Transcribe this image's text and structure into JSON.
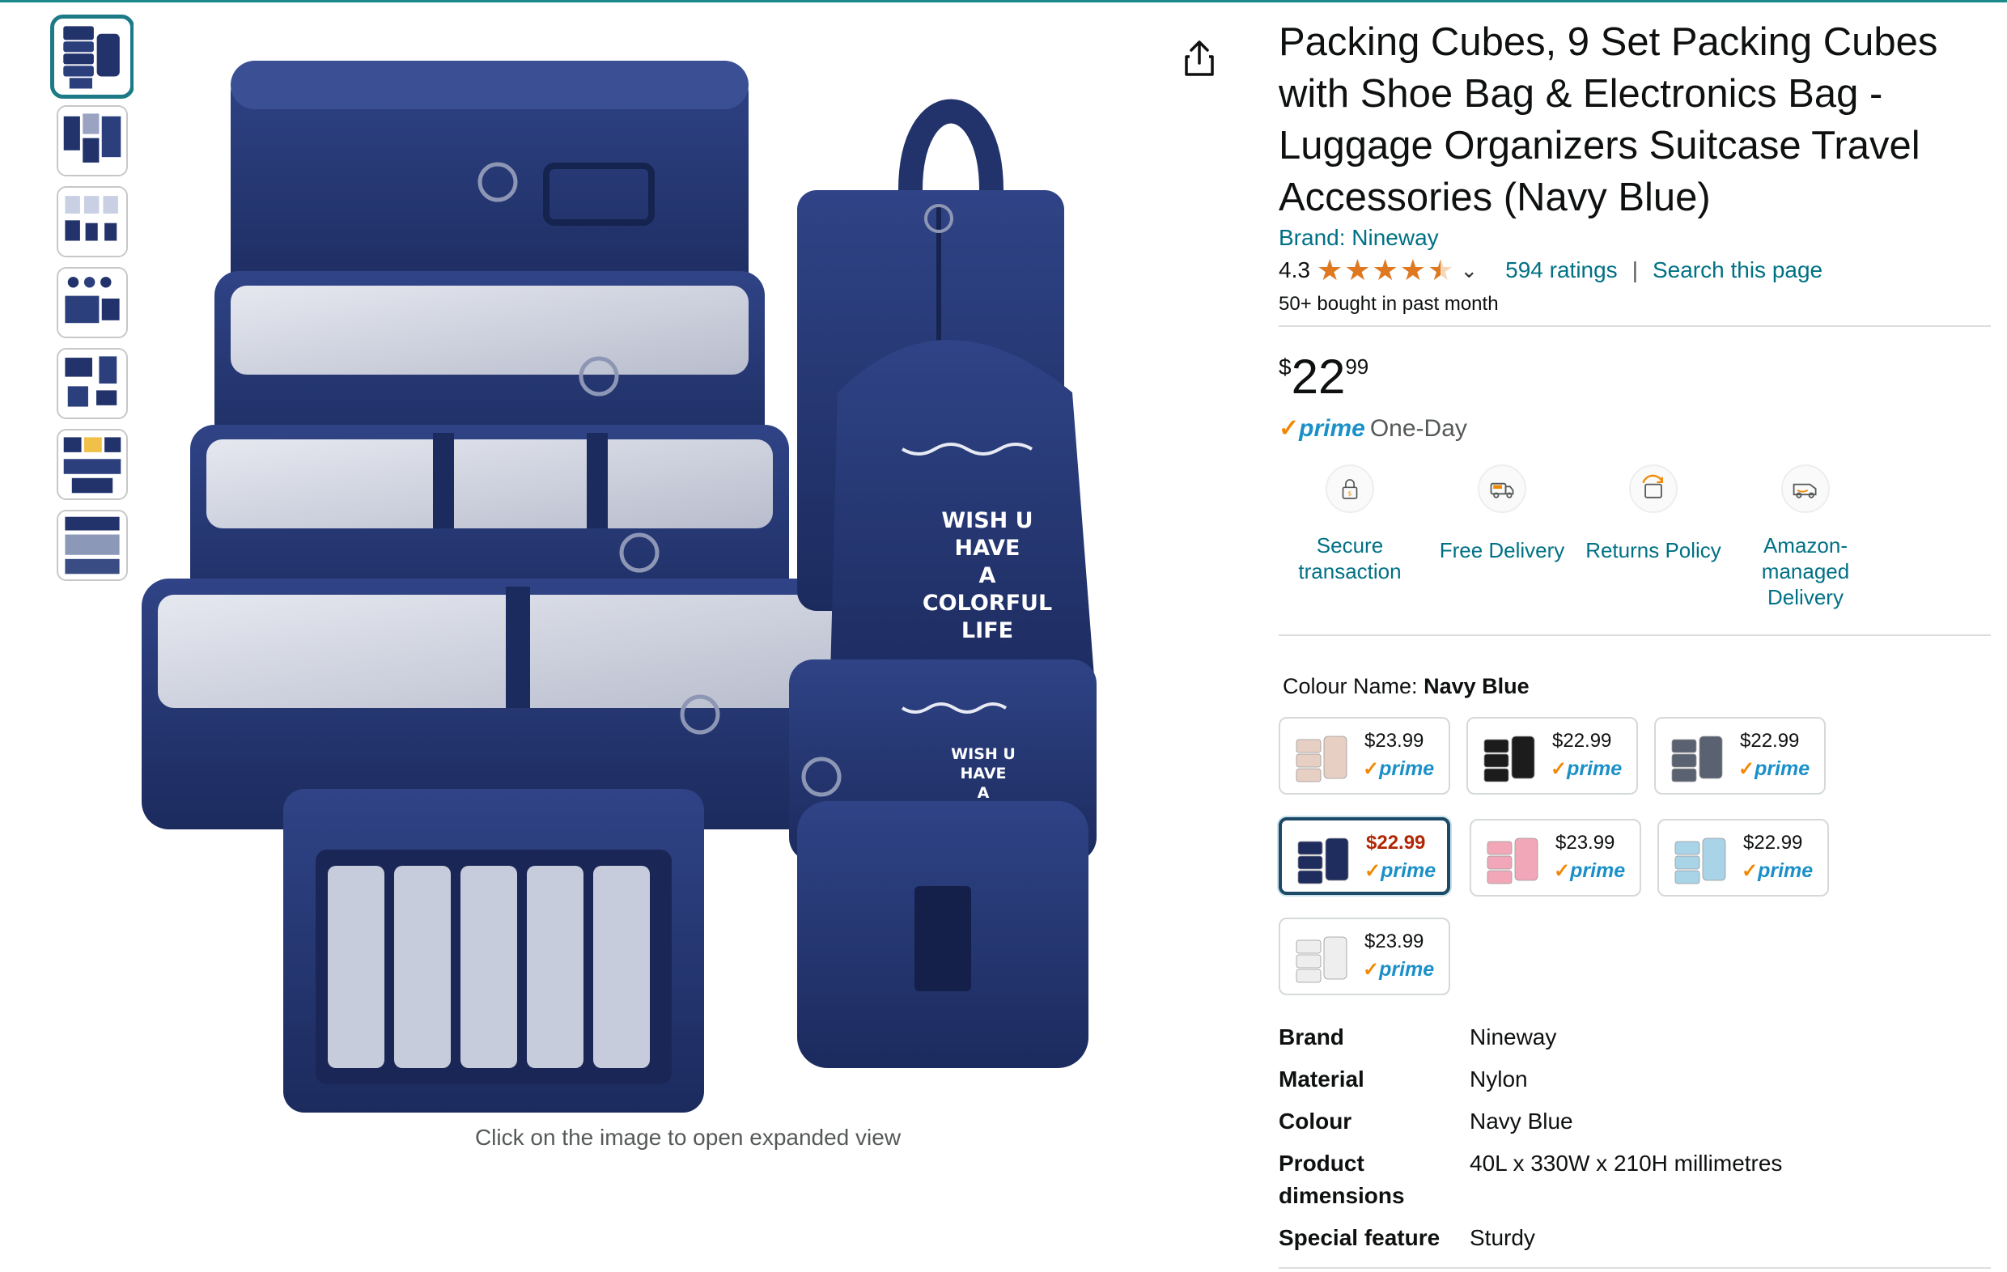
{
  "product": {
    "title": "Packing Cubes, 9 Set Packing Cubes with Shoe Bag & Electronics Bag - Luggage Organizers Suitcase Travel Accessories (Navy Blue)",
    "brand_link": "Brand: Nineway",
    "rating_value": "4.3",
    "stars": 4.3,
    "ratings_count": "594 ratings",
    "search_link": "Search this page",
    "bought": "50+ bought in past month",
    "price_symbol": "$",
    "price_whole": "22",
    "price_fraction": "99",
    "prime_check": "✓",
    "prime_word": "prime",
    "prime_speed": "One-Day"
  },
  "gallery": {
    "thumbnail_count": 7,
    "selected_index": 0,
    "caption": "Click on the image to open expanded view",
    "hero_texts": {
      "drawstring": [
        "WISH U",
        "HAVE",
        "A",
        "COLORFUL",
        "LIFE"
      ],
      "pouch": [
        "WISH U",
        "HAVE",
        "A"
      ]
    }
  },
  "badges": [
    {
      "label": "Secure transaction",
      "icon": "lock-icon"
    },
    {
      "label": "Free Delivery",
      "icon": "truck-icon"
    },
    {
      "label": "Returns Policy",
      "icon": "return-box-icon"
    },
    {
      "label": "Amazon-managed Delivery",
      "icon": "van-icon"
    }
  ],
  "colour": {
    "label": "Colour Name:",
    "selected": "Navy Blue",
    "swatches": [
      {
        "price": "$23.99",
        "prime": "prime",
        "tint": "#e8cfc4"
      },
      {
        "price": "$22.99",
        "prime": "prime",
        "tint": "#1c1c1c"
      },
      {
        "price": "$22.99",
        "prime": "prime",
        "tint": "#5a6170"
      },
      {
        "price": "$22.99",
        "prime": "prime",
        "tint": "#1e2c5e",
        "selected": true
      },
      {
        "price": "$23.99",
        "prime": "prime",
        "tint": "#f2a7b8"
      },
      {
        "price": "$22.99",
        "prime": "prime",
        "tint": "#a9d3e6"
      },
      {
        "price": "$23.99",
        "prime": "prime",
        "tint": "#eeeeee"
      }
    ]
  },
  "specs": [
    {
      "key": "Brand",
      "value": "Nineway"
    },
    {
      "key": "Material",
      "value": "Nylon"
    },
    {
      "key": "Colour",
      "value": "Navy Blue"
    },
    {
      "key": "Product dimensions",
      "value": "40L x 330W x 210H millimetres"
    },
    {
      "key": "Special feature",
      "value": "Sturdy"
    }
  ],
  "colors": {
    "link": "#007185",
    "star": "#de7921",
    "prime_blue": "#1b90c8",
    "prime_check": "#f08804",
    "navy": "#22336b",
    "selected_border": "#1c4966"
  }
}
